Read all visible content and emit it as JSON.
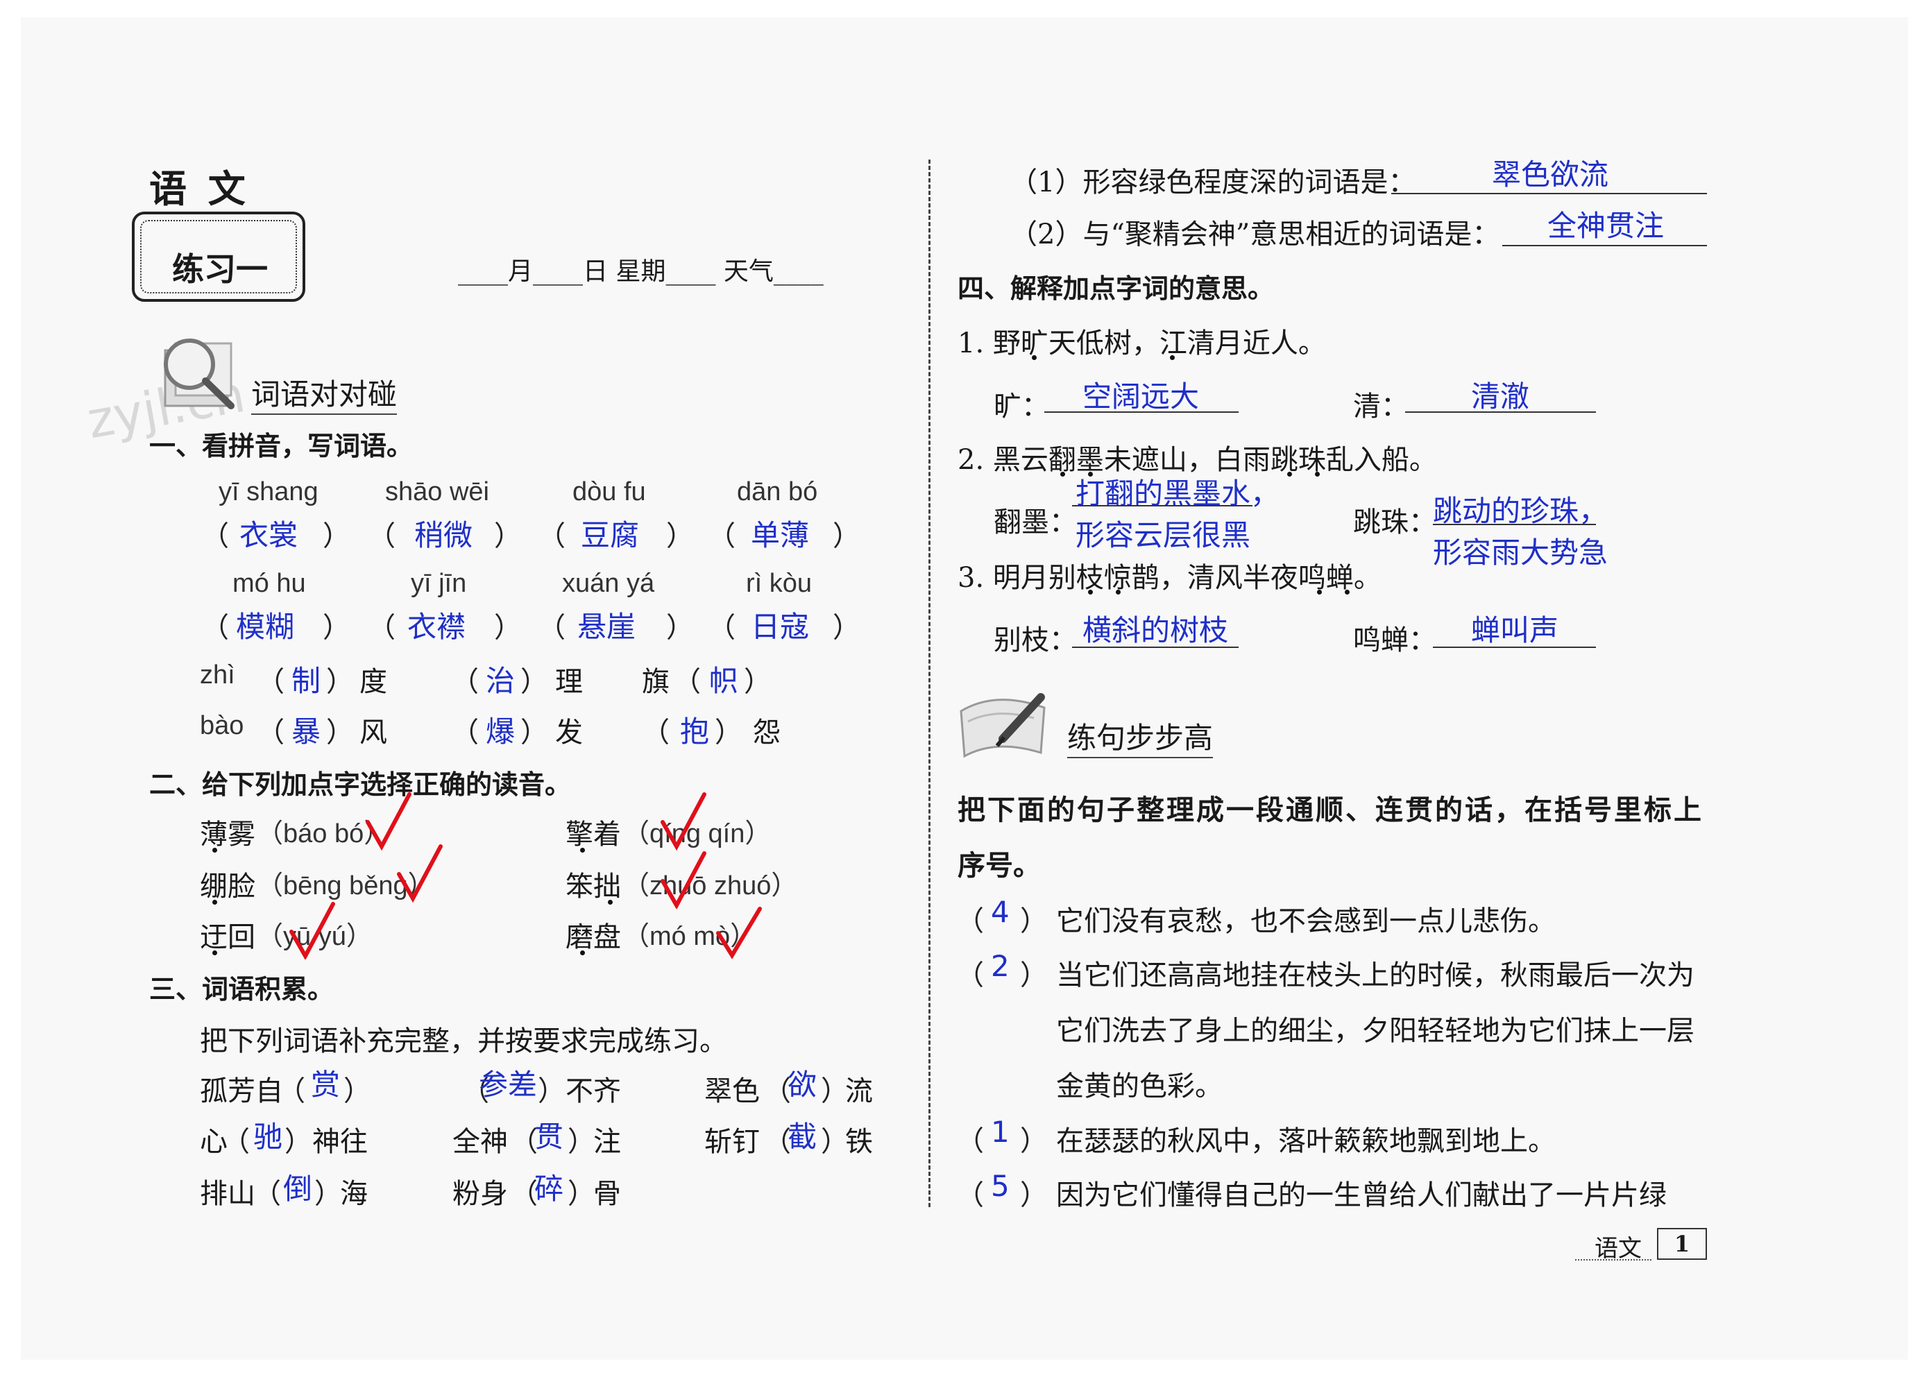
{
  "header": {
    "subject": "语  文",
    "exercise": "练习一",
    "date_line": "____月____日  星期____    天气____"
  },
  "watermark": "zyjl.cn",
  "section_vocab": {
    "banner": "词语对对碰",
    "q1": {
      "title": "一、看拼音，写词语。",
      "row1": [
        {
          "pinyin": "yī shang",
          "answer": "衣裳"
        },
        {
          "pinyin": "shāo wēi",
          "answer": "稍微"
        },
        {
          "pinyin": "dòu fu",
          "answer": "豆腐"
        },
        {
          "pinyin": "dān bó",
          "answer": "单薄"
        }
      ],
      "row2": [
        {
          "pinyin": "mó hu",
          "answer": "模糊"
        },
        {
          "pinyin": "yī jīn",
          "answer": "衣襟"
        },
        {
          "pinyin": "xuán yá",
          "answer": "悬崖"
        },
        {
          "pinyin": "rì kòu",
          "answer": "日寇"
        }
      ],
      "zhi": {
        "pinyin": "zhì",
        "items": [
          {
            "pre": "",
            "ans": "制",
            "post": "度"
          },
          {
            "pre": "",
            "ans": "治",
            "post": "理"
          },
          {
            "pre": "旗",
            "ans": "帜",
            "post": ""
          }
        ]
      },
      "bao": {
        "pinyin": "bào",
        "items": [
          {
            "pre": "",
            "ans": "暴",
            "post": "风"
          },
          {
            "pre": "",
            "ans": "爆",
            "post": "发"
          },
          {
            "pre": "",
            "ans": "抱",
            "post": "怨"
          }
        ]
      }
    },
    "q2": {
      "title": "二、给下列加点字选择正确的读音。",
      "items": [
        {
          "word": "薄雾",
          "options": "（báo   bó）"
        },
        {
          "word": "擎着",
          "options": "（qíng   qín）"
        },
        {
          "word": "绷脸",
          "options": "（bēng   běng）"
        },
        {
          "word": "笨拙",
          "options": "（zhuō   zhuó）"
        },
        {
          "word": "迂回",
          "options": "（yū   yú）"
        },
        {
          "word": "磨盘",
          "options": "（mó   mò）"
        }
      ]
    },
    "q3": {
      "title": "三、词语积累。",
      "instruction": "把下列词语补充完整，并按要求完成练习。",
      "idioms": [
        {
          "pre": "孤芳自",
          "ans": "赏",
          "post": ""
        },
        {
          "pre": "",
          "ans": "参差",
          "post": "不齐"
        },
        {
          "pre": "翠色",
          "ans": "欲",
          "post": "流"
        },
        {
          "pre": "心",
          "ans": "驰",
          "post": "神往"
        },
        {
          "pre": "全神",
          "ans": "贯",
          "post": "注"
        },
        {
          "pre": "斩钉",
          "ans": "截",
          "post": "铁"
        },
        {
          "pre": "排山",
          "ans": "倒",
          "post": "海"
        },
        {
          "pre": "粉身",
          "ans": "碎",
          "post": "骨"
        }
      ],
      "sub1": {
        "label": "（1）形容绿色程度深的词语是：",
        "ans": "翠色欲流"
      },
      "sub2": {
        "label": "（2）与“聚精会神”意思相近的词语是：",
        "ans": "全神贯注"
      }
    },
    "q4": {
      "title": "四、解释加点字词的意思。",
      "s1": "1. 野旷天低树，江清月近人。",
      "s1a": {
        "label": "旷：",
        "ans": "空阔远大"
      },
      "s1b": {
        "label": "清：",
        "ans": "清澈"
      },
      "s2": "2. 黑云翻墨未遮山，白雨跳珠乱入船。",
      "s2a": {
        "label": "翻墨：",
        "ans1": "打翻的黑墨水，",
        "ans2": "形容云层很黑"
      },
      "s2b": {
        "label": "跳珠：",
        "ans1": "跳动的珍珠，",
        "ans2": "形容雨大势急"
      },
      "s3": "3. 明月别枝惊鹊，清风半夜鸣蝉。",
      "s3a": {
        "label": "别枝：",
        "ans": "横斜的树枝"
      },
      "s3b": {
        "label": "鸣蝉：",
        "ans": "蝉叫声"
      }
    }
  },
  "section_sentence": {
    "banner": "练句步步高",
    "instruction1": "把下面的句子整理成一段通顺、连贯的话，在括号里标上",
    "instruction2": "序号。",
    "items": [
      {
        "num": "4",
        "text": "它们没有哀愁，也不会感到一点儿悲伤。"
      },
      {
        "num": "2",
        "text": "当它们还高高地挂在枝头上的时候，秋雨最后一次为",
        "cont1": "它们洗去了身上的细尘，夕阳轻轻地为它们抹上一层",
        "cont2": "金黄的色彩。"
      },
      {
        "num": "1",
        "text": "在瑟瑟的秋风中，落叶簌簌地飘到地上。"
      },
      {
        "num": "5",
        "text": "因为它们懂得自己的一生曾给人们献出了一片片绿"
      }
    ]
  },
  "footer": {
    "subject": "语文",
    "page": "1"
  },
  "colors": {
    "answer": "#1f2fc8",
    "check": "#e0101a"
  }
}
